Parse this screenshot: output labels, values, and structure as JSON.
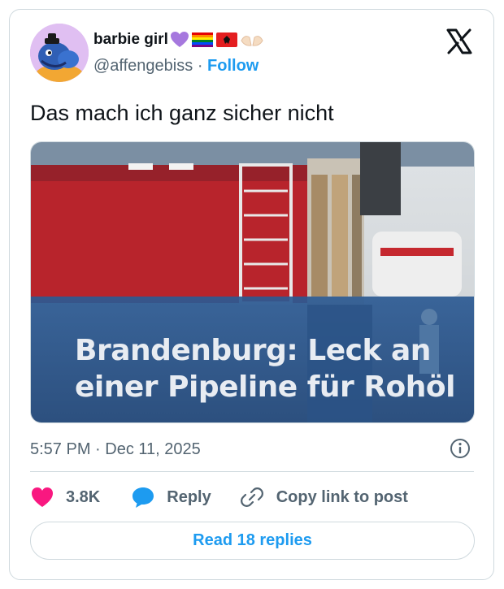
{
  "author": {
    "display_name": "barbie girl",
    "handle": "@affengebiss",
    "separator": "·",
    "follow_label": "Follow",
    "name_emojis": [
      "purple-heart",
      "rainbow-flag",
      "albanian-flag",
      "palms-up"
    ]
  },
  "tweet": {
    "text": "Das mach ich ganz sicher nicht",
    "media_caption_line1": "Brandenburg: Leck an",
    "media_caption_line2": "einer Pipeline für Rohöl",
    "time": "5:57 PM",
    "date_separator": "·",
    "date": "Dec 11, 2025"
  },
  "actions": {
    "likes_count": "3.8K",
    "reply_label": "Reply",
    "copy_link_label": "Copy link to post",
    "read_replies_label": "Read 18 replies"
  },
  "icons": {
    "platform": "x-logo-icon",
    "info": "info-icon",
    "like": "heart-icon",
    "reply": "speech-bubble-icon",
    "copy": "link-icon"
  },
  "colors": {
    "accent": "#1d9bf0",
    "heart": "#f91880",
    "text_secondary": "#536471",
    "border": "#cfd9de"
  }
}
